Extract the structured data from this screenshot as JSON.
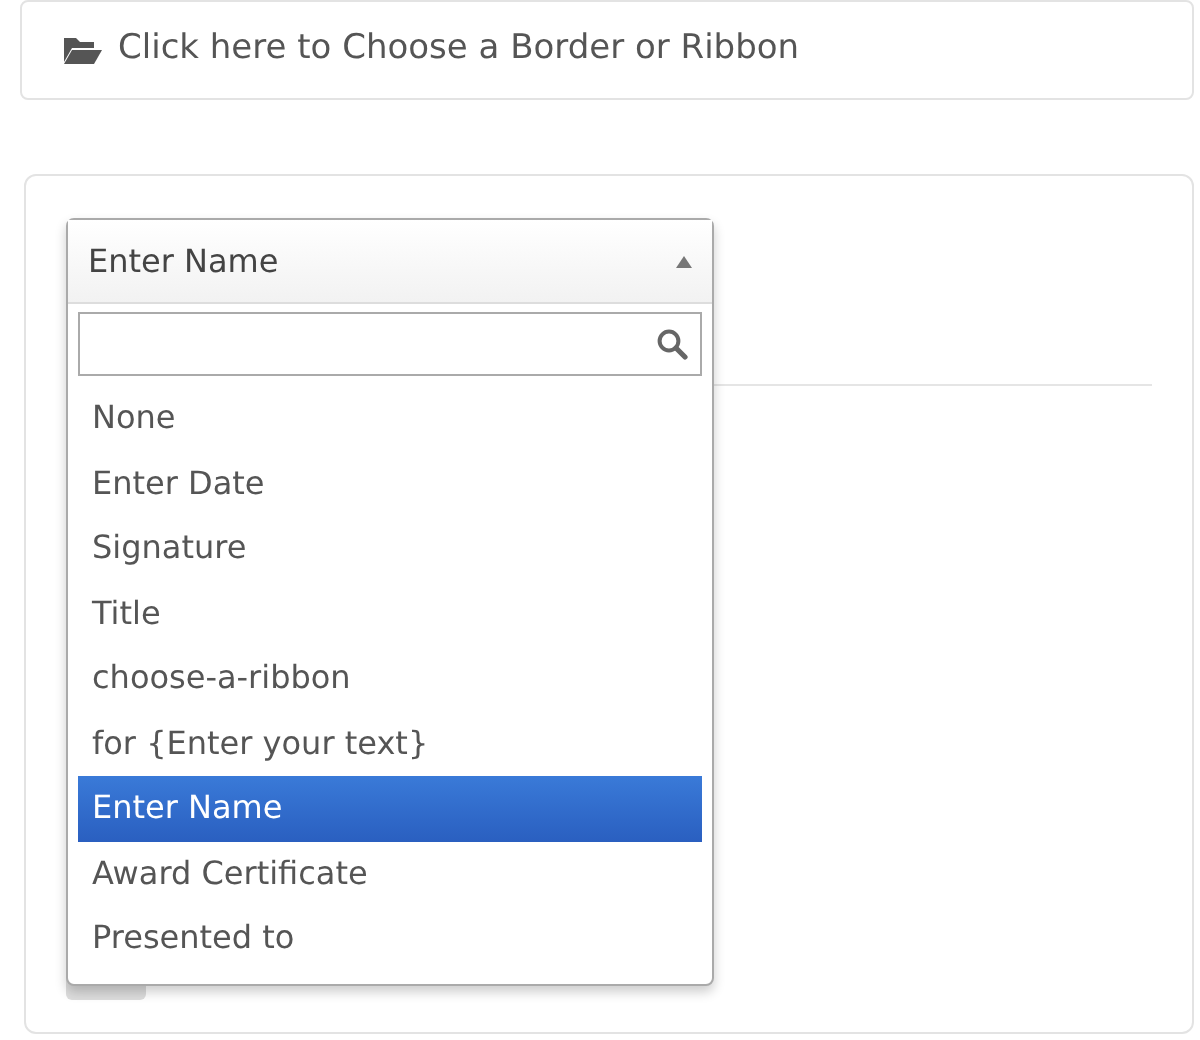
{
  "border_button": {
    "label": "Click here to Choose a Border or Ribbon"
  },
  "select": {
    "value": "Enter Name",
    "expanded": true,
    "options": [
      {
        "label": "None",
        "selected": false
      },
      {
        "label": "Enter Date",
        "selected": false
      },
      {
        "label": "Signature",
        "selected": false
      },
      {
        "label": "Title",
        "selected": false
      },
      {
        "label": "choose-a-ribbon",
        "selected": false
      },
      {
        "label": "for {Enter your text}",
        "selected": false
      },
      {
        "label": "Enter Name",
        "selected": true
      },
      {
        "label": "Award Certificate",
        "selected": false
      },
      {
        "label": "Presented to",
        "selected": false
      }
    ]
  }
}
